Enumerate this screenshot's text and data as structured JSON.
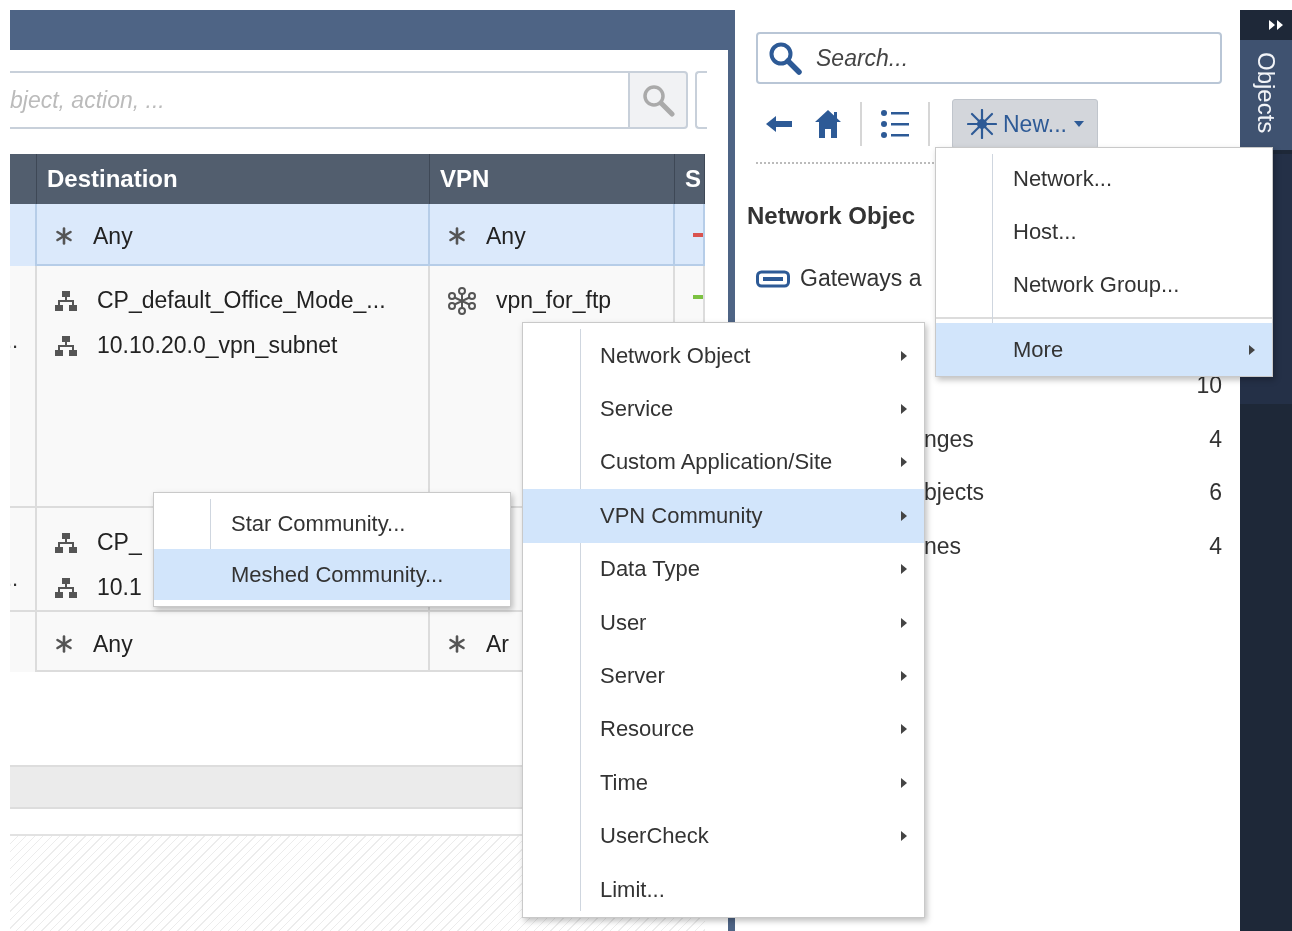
{
  "rulebase": {
    "search": {
      "placeholder": "bject, action, ..."
    },
    "table": {
      "columns": [
        "Destination",
        "VPN",
        "S"
      ],
      "rows": [
        {
          "selected": true,
          "destination": [
            {
              "kind": "any",
              "text": "Any"
            }
          ],
          "vpn": [
            {
              "kind": "any",
              "text": "Any"
            }
          ],
          "color": "#d9534f"
        },
        {
          "selected": false,
          "lead": "..",
          "destination": [
            {
              "kind": "network",
              "text": "CP_default_Office_Mode_..."
            },
            {
              "kind": "network",
              "text": "10.10.20.0_vpn_subnet"
            }
          ],
          "vpn": [
            {
              "kind": "community",
              "text": "vpn_for_ftp"
            }
          ],
          "color": "#7cc242"
        },
        {
          "selected": false,
          "lead": "..",
          "destination": [
            {
              "kind": "network",
              "text": "CP_"
            },
            {
              "kind": "network",
              "text": "10.1"
            }
          ],
          "vpn": []
        },
        {
          "selected": false,
          "destination": [
            {
              "kind": "any",
              "text": "Any"
            }
          ],
          "vpn": [
            {
              "kind": "any",
              "text": "Ar"
            }
          ]
        }
      ]
    }
  },
  "objects_panel": {
    "search": {
      "placeholder": "Search..."
    },
    "new_button": "New...",
    "heading": "Network Objec",
    "items": [
      {
        "kind": "gateway",
        "label": "Gateways a"
      },
      {
        "kind": "partial",
        "count": "10"
      },
      {
        "kind": "partial",
        "label": "nges",
        "count": "4"
      },
      {
        "kind": "partial",
        "label": "bjects",
        "count": "6"
      },
      {
        "kind": "partial",
        "label": "nes",
        "count": "4"
      }
    ]
  },
  "side_tabs": [
    {
      "label": "Objects",
      "selected": true
    }
  ],
  "new_menu": [
    {
      "label": "Network...",
      "selected": false
    },
    {
      "label": "Host...",
      "selected": false
    },
    {
      "label": "Network Group...",
      "selected": false
    },
    {
      "label": "More",
      "selected": true,
      "separator_before": true,
      "submenu": true
    }
  ],
  "more_menu": [
    {
      "label": "Network Object",
      "selected": false,
      "submenu": true
    },
    {
      "label": "Service",
      "selected": false,
      "submenu": true
    },
    {
      "label": "Custom Application/Site",
      "selected": false,
      "submenu": true
    },
    {
      "label": "VPN Community",
      "selected": true,
      "submenu": true
    },
    {
      "label": "Data Type",
      "selected": false,
      "submenu": true
    },
    {
      "label": "User",
      "selected": false,
      "submenu": true
    },
    {
      "label": "Server",
      "selected": false,
      "submenu": true
    },
    {
      "label": "Resource",
      "selected": false,
      "submenu": true
    },
    {
      "label": "Time",
      "selected": false,
      "submenu": true
    },
    {
      "label": "UserCheck",
      "selected": false,
      "submenu": true
    },
    {
      "label": "Limit...",
      "selected": false,
      "submenu": false
    }
  ],
  "community_menu": [
    {
      "label": "Star Community...",
      "selected": false
    },
    {
      "label": "Meshed Community...",
      "selected": true
    }
  ]
}
